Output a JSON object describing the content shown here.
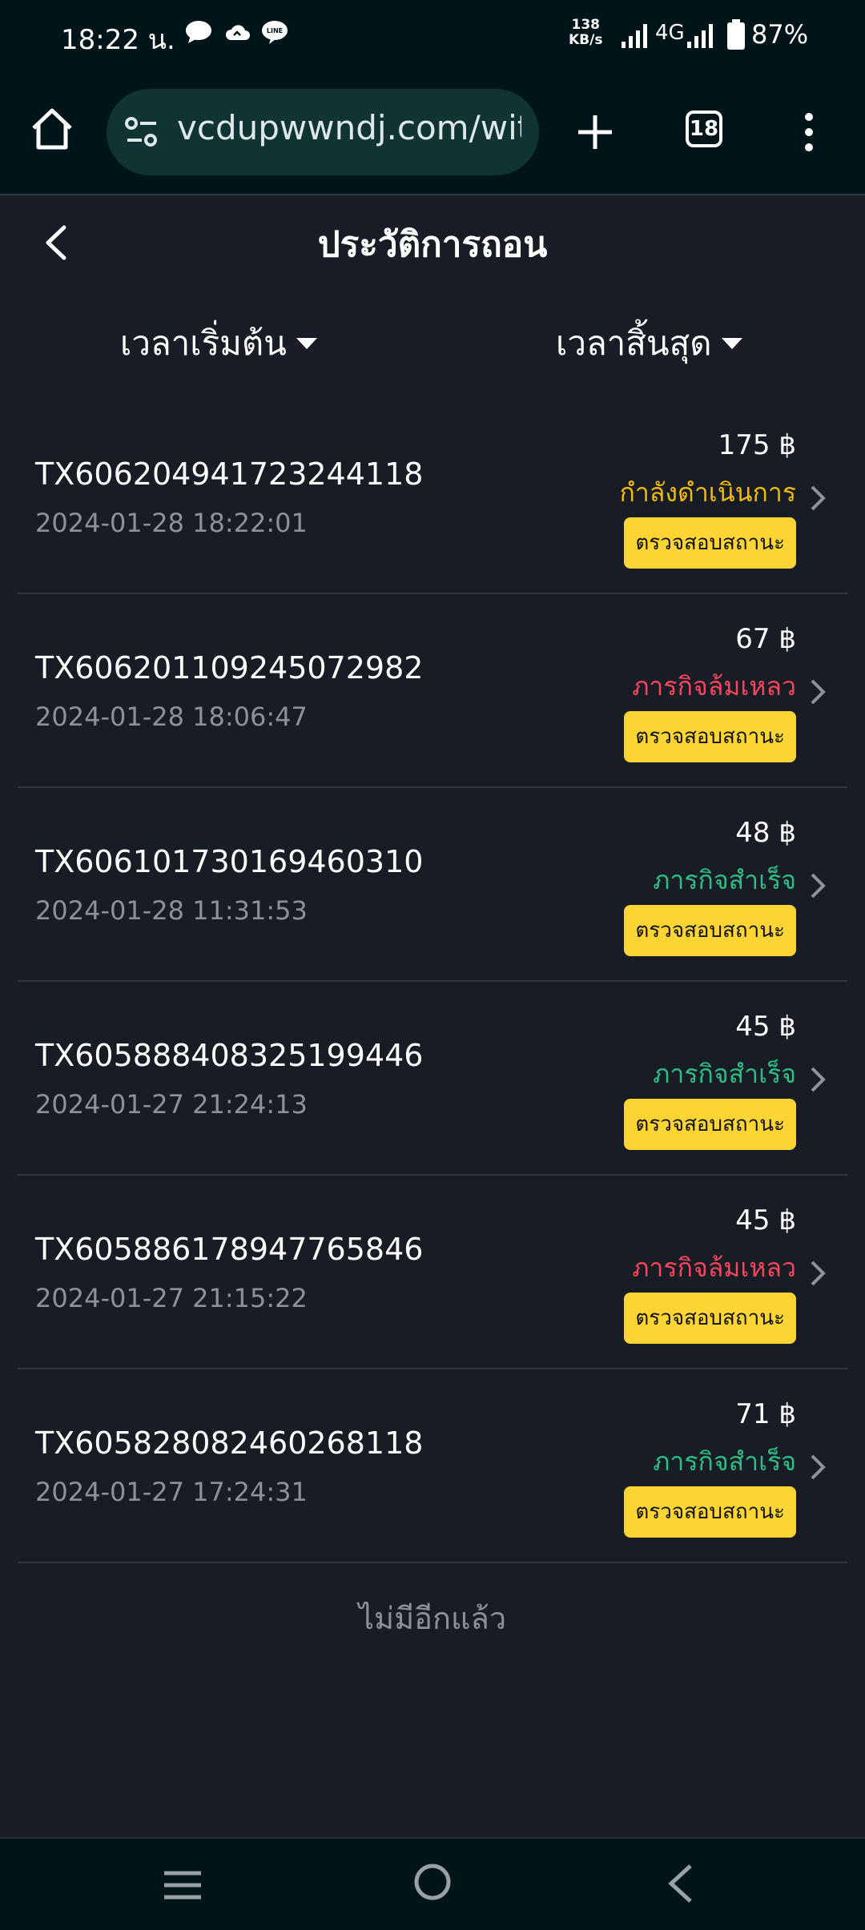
{
  "status_bar": {
    "time": "18:22 น.",
    "net_speed_value": "138",
    "net_speed_unit": "KB/s",
    "network_type": "4G",
    "battery": "87%"
  },
  "browser": {
    "url": "vcdupwwndj.com/withdrawal",
    "tab_count": "18"
  },
  "page": {
    "title": "ประวัติการถอน",
    "filter_start": "เวลาเริ่มต้น",
    "filter_end": "เวลาสิ้นสุด",
    "end_of_list": "ไม่มีอีกแล้ว"
  },
  "colors": {
    "processing": "#f0b90b",
    "failed": "#f6465d",
    "success": "#2ebd85",
    "button": "#fcd535"
  },
  "transactions": [
    {
      "id": "TX606204941723244118",
      "time": "2024-01-28 18:22:01",
      "amount": "175 ฿",
      "status": "กำลังดำเนินการ",
      "status_type": "processing",
      "check_label": "ตรวจสอบสถานะ"
    },
    {
      "id": "TX606201109245072982",
      "time": "2024-01-28 18:06:47",
      "amount": "67 ฿",
      "status": "ภารกิจล้มเหลว",
      "status_type": "failed",
      "check_label": "ตรวจสอบสถานะ"
    },
    {
      "id": "TX606101730169460310",
      "time": "2024-01-28 11:31:53",
      "amount": "48 ฿",
      "status": "ภารกิจสำเร็จ",
      "status_type": "success",
      "check_label": "ตรวจสอบสถานะ"
    },
    {
      "id": "TX605888408325199446",
      "time": "2024-01-27 21:24:13",
      "amount": "45 ฿",
      "status": "ภารกิจสำเร็จ",
      "status_type": "success",
      "check_label": "ตรวจสอบสถานะ"
    },
    {
      "id": "TX605886178947765846",
      "time": "2024-01-27 21:15:22",
      "amount": "45 ฿",
      "status": "ภารกิจล้มเหลว",
      "status_type": "failed",
      "check_label": "ตรวจสอบสถานะ"
    },
    {
      "id": "TX605828082460268118",
      "time": "2024-01-27 17:24:31",
      "amount": "71 ฿",
      "status": "ภารกิจสำเร็จ",
      "status_type": "success",
      "check_label": "ตรวจสอบสถานะ"
    }
  ]
}
